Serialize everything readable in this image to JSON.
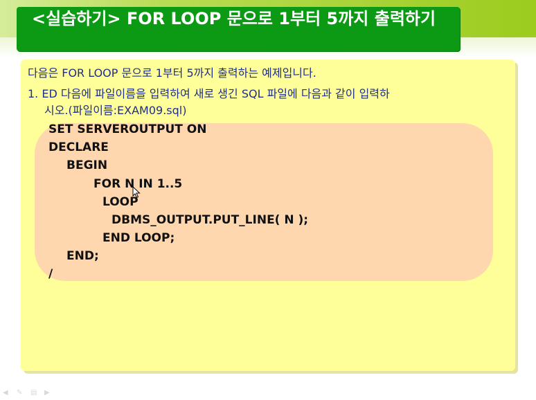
{
  "slide": {
    "title": "<실습하기> FOR LOOP 문으로 1부터 5까지 출력하기",
    "intro": "다음은 FOR LOOP 문으로 1부터 5까지 출력하는 예제입니다.",
    "step1_line1": "1. ED 다음에 파일이름을 입력하여 새로 생긴 SQL 파일에 다음과 같이 입력하",
    "step1_line2": "시오.(파일이름:EXAM09.sql)"
  },
  "code": {
    "lines": [
      "SET SERVEROUTPUT ON",
      "DECLARE",
      "BEGIN",
      "FOR N IN 1..5",
      "LOOP",
      "DBMS_OUTPUT.PUT_LINE( N );",
      "END LOOP;",
      "END;",
      "/"
    ]
  },
  "colors": {
    "title_bg": "#0c9a14",
    "panel_bg": "#ffff99",
    "code_bg": "#ffd7ae",
    "text_blue": "#1f2e86"
  },
  "footer": {
    "icons": [
      "prev-icon",
      "menu-icon",
      "notes-icon",
      "next-icon"
    ]
  }
}
